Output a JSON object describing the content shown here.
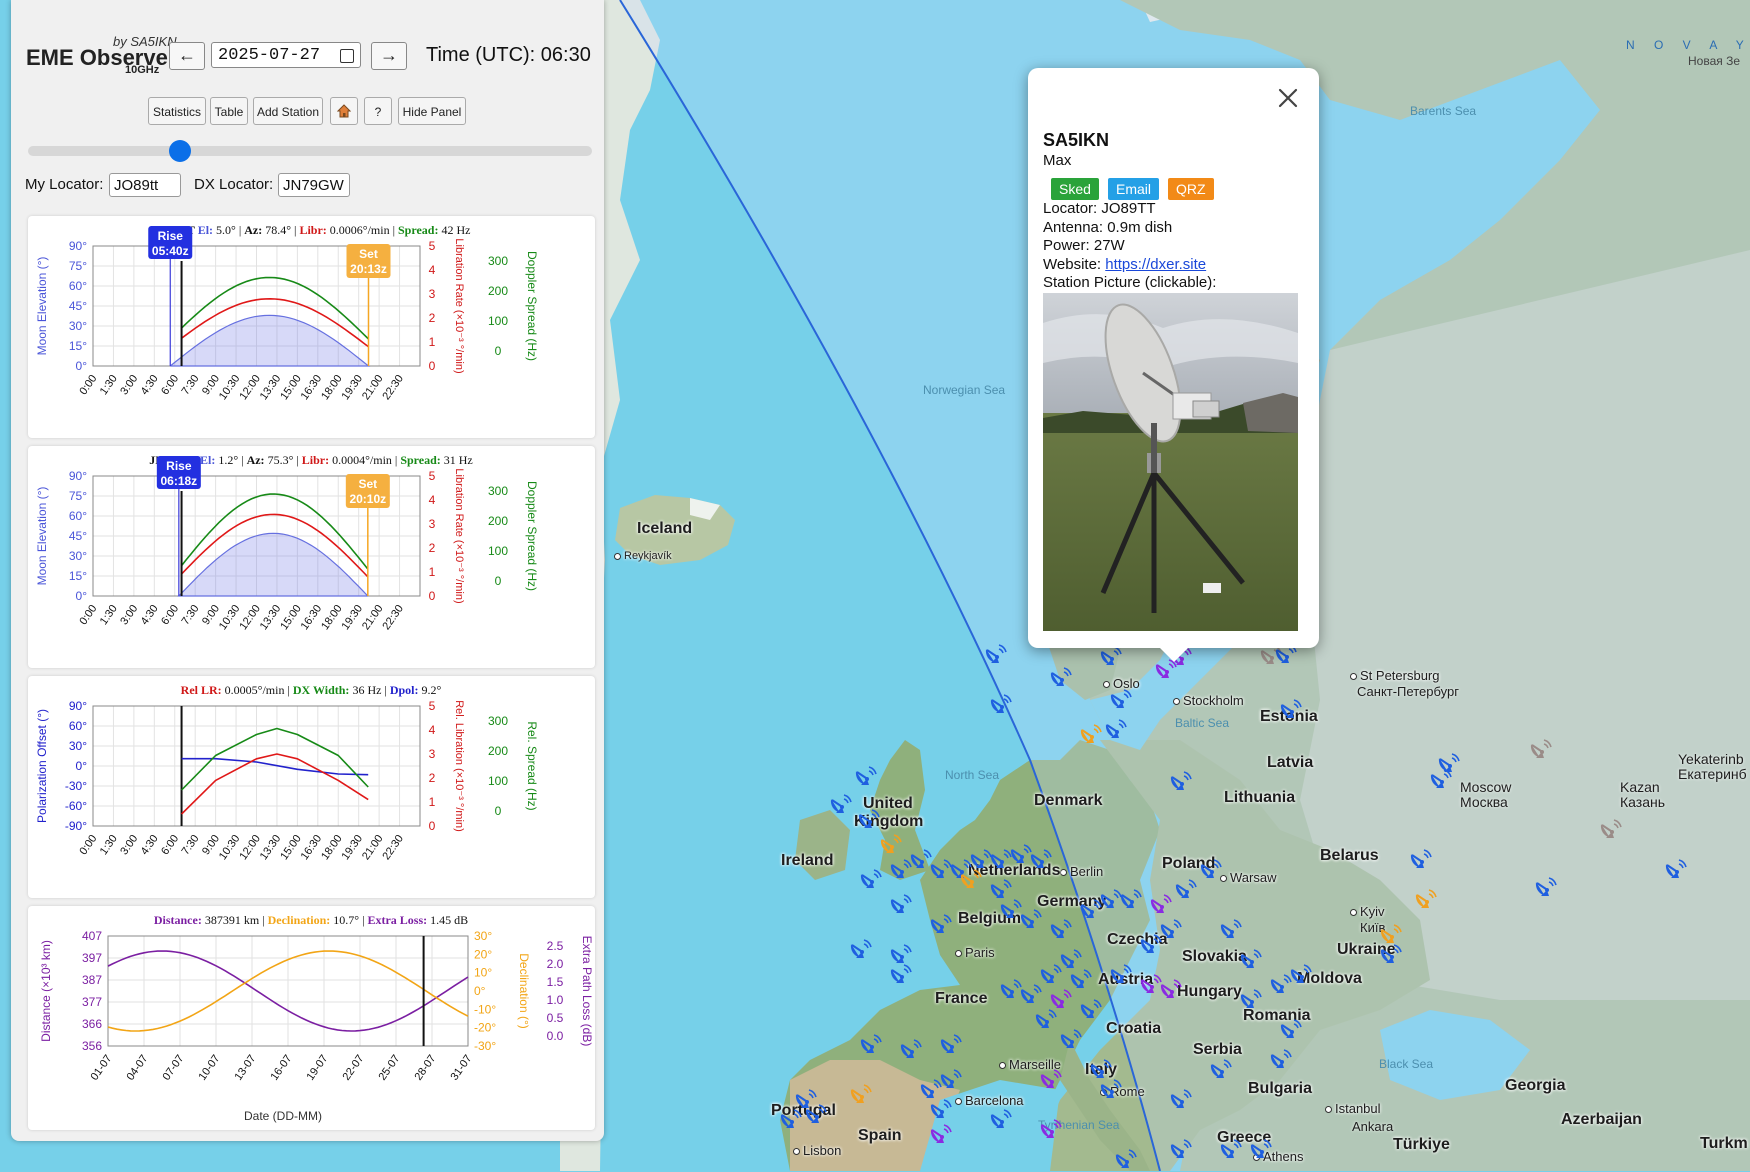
{
  "app": {
    "by_line": "by SA5IKN",
    "title": "EME Observer",
    "band": "10GHz",
    "prev_day_label": "←",
    "next_day_label": "→",
    "date_value": "2025-07-27",
    "time_text": "Time (UTC): 06:30"
  },
  "toolbar": {
    "statistics": "Statistics",
    "table": "Table",
    "add_station": "Add Station",
    "home_icon": "house-icon",
    "help": "?",
    "hide_panel": "Hide Panel"
  },
  "time_slider": {
    "value_fraction": 0.27
  },
  "locators": {
    "my_label": "My Locator:",
    "my_value": "JO89tt",
    "dx_label": "DX Locator:",
    "dx_value": "JN79GW"
  },
  "chart_data": [
    {
      "type": "line",
      "header": {
        "loc": "JO89TT",
        "el": "5.0°",
        "az": "78.4°",
        "libr": "0.0006°/min",
        "spread": "42 Hz"
      },
      "header_labels": {
        "el": "El:",
        "az": "Az:",
        "libr": "Libr:",
        "spread": "Spread:"
      },
      "ylabel_left": "Moon Elevation (°)",
      "ylabel_mid": "Libration Rate (×10⁻³ °/min)",
      "ylabel_right": "Doppler Spread (Hz)",
      "y_left_ticks": [
        "90°",
        "75°",
        "60°",
        "45°",
        "30°",
        "15°",
        "0°"
      ],
      "y_mid_ticks": [
        "5",
        "4",
        "3",
        "2",
        "1",
        "0"
      ],
      "y_right_ticks": [
        "300",
        "200",
        "100",
        "0"
      ],
      "x_ticks": [
        "0:00",
        "1:30",
        "3:00",
        "4:30",
        "6:00",
        "7:30",
        "9:00",
        "10:30",
        "12:00",
        "13:30",
        "15:00",
        "16:30",
        "18:00",
        "19:30",
        "21:00",
        "22:30"
      ],
      "xlim": [
        0,
        24
      ],
      "rise": {
        "label": "Rise",
        "time": "05:40z",
        "hour": 5.67
      },
      "set": {
        "label": "Set",
        "time": "20:13z",
        "hour": 20.22
      },
      "current_hour": 6.5,
      "elevation_peak_deg": 38,
      "libration_peak": 2.8,
      "spread_peak_hz": 245,
      "series_colors": {
        "elevation": "#6670e0",
        "libration": "#e01818",
        "spread": "#178a17"
      }
    },
    {
      "type": "line",
      "header": {
        "loc": "JN79GW",
        "el": "1.2°",
        "az": "75.3°",
        "libr": "0.0004°/min",
        "spread": "31 Hz"
      },
      "header_labels": {
        "el": "El:",
        "az": "Az:",
        "libr": "Libr:",
        "spread": "Spread:"
      },
      "ylabel_left": "Moon Elevation (°)",
      "ylabel_mid": "Libration Rate (×10⁻³ °/min)",
      "ylabel_right": "Doppler Spread (Hz)",
      "y_left_ticks": [
        "90°",
        "75°",
        "60°",
        "45°",
        "30°",
        "15°",
        "0°"
      ],
      "y_mid_ticks": [
        "5",
        "4",
        "3",
        "2",
        "1",
        "0"
      ],
      "y_right_ticks": [
        "300",
        "200",
        "100",
        "0"
      ],
      "x_ticks": [
        "0:00",
        "1:30",
        "3:00",
        "4:30",
        "6:00",
        "7:30",
        "9:00",
        "10:30",
        "12:00",
        "13:30",
        "15:00",
        "16:30",
        "18:00",
        "19:30",
        "21:00",
        "22:30"
      ],
      "xlim": [
        0,
        24
      ],
      "rise": {
        "label": "Rise",
        "time": "06:18z",
        "hour": 6.3
      },
      "set": {
        "label": "Set",
        "time": "20:10z",
        "hour": 20.17
      },
      "current_hour": 6.5,
      "elevation_peak_deg": 47,
      "libration_peak": 3.4,
      "spread_peak_hz": 290,
      "series_colors": {
        "elevation": "#6670e0",
        "libration": "#e01818",
        "spread": "#178a17"
      }
    },
    {
      "type": "line",
      "header": {
        "rel_lr": "0.0005°/min",
        "dx_width": "36 Hz",
        "dpol": "9.2°"
      },
      "header_labels": {
        "rel_lr": "Rel LR:",
        "dx_width": "DX Width:",
        "dpol": "Dpol:"
      },
      "ylabel_left": "Polarization Offset (°)",
      "ylabel_mid": "Rel. Libration (×10⁻³ °/min)",
      "ylabel_right": "Rel. Spread (Hz)",
      "y_left_ticks": [
        "90°",
        "60°",
        "30°",
        "0°",
        "-30°",
        "-60°",
        "-90°"
      ],
      "y_mid_ticks": [
        "5",
        "4",
        "3",
        "2",
        "1",
        "0"
      ],
      "y_right_ticks": [
        "300",
        "200",
        "100",
        "0"
      ],
      "x_ticks": [
        "0:00",
        "1:30",
        "3:00",
        "4:30",
        "6:00",
        "7:30",
        "9:00",
        "10:30",
        "12:00",
        "13:30",
        "15:00",
        "16:30",
        "18:00",
        "19:30",
        "21:00",
        "22:30"
      ],
      "xlim": [
        0,
        24
      ],
      "current_hour": 6.5,
      "series": [
        {
          "name": "Polarization Offset",
          "color": "#2222cc",
          "x": [
            6.5,
            9,
            12,
            15,
            18,
            20.2
          ],
          "y": [
            11,
            11,
            6,
            -5,
            -12,
            -13
          ]
        },
        {
          "name": "Rel. Libration",
          "color": "#e01818",
          "x": [
            6.5,
            9,
            12,
            13.5,
            15,
            18,
            20.2
          ],
          "y": [
            0.5,
            1.9,
            2.8,
            3.0,
            2.8,
            1.9,
            1.1
          ]
        },
        {
          "name": "Rel. Spread",
          "color": "#178a17",
          "x": [
            6.5,
            9,
            12,
            13.5,
            15,
            18,
            20.2
          ],
          "y": [
            70,
            185,
            255,
            275,
            255,
            185,
            80
          ]
        }
      ]
    },
    {
      "type": "line",
      "header": {
        "distance": "387391 km",
        "declination": "10.7°",
        "extra_loss": "1.45 dB"
      },
      "header_labels": {
        "distance": "Distance:",
        "declination": "Declination:",
        "extra_loss": "Extra Loss:"
      },
      "xlabel": "Date (DD-MM)",
      "ylabel_left": "Distance (×10³ km)",
      "ylabel_mid": "Declination (°)",
      "ylabel_right": "Extra Path Loss (dB)",
      "y_left_ticks": [
        "407",
        "397",
        "387",
        "377",
        "366",
        "356"
      ],
      "y_mid_ticks": [
        "30°",
        "20°",
        "10°",
        "0°",
        "-10°",
        "-20°",
        "-30°"
      ],
      "y_right_ticks": [
        "2.5",
        "2.0",
        "1.5",
        "1.0",
        "0.5",
        "0.0"
      ],
      "x_ticks": [
        "01-07",
        "04-07",
        "07-07",
        "10-07",
        "13-07",
        "16-07",
        "19-07",
        "22-07",
        "25-07",
        "28-07",
        "31-07"
      ],
      "current_day": 27.3,
      "series": [
        {
          "name": "Distance",
          "color": "#7b1fa2"
        },
        {
          "name": "Declination",
          "color": "#f2a516"
        }
      ]
    }
  ],
  "popup": {
    "close_icon": "close-icon",
    "callsign": "SA5IKN",
    "name": "Max",
    "sked": "Sked",
    "email": "Email",
    "qrz": "QRZ",
    "locator": "Locator: JO89TT",
    "antenna": "Antenna: 0.9m dish",
    "power": "Power: 27W",
    "website_label": "Website: ",
    "website_link": "https://dxer.site",
    "picture_label": "Station Picture (clickable):",
    "picture_icon": "station-dish-photo",
    "colors": {
      "sked": "#2aa33a",
      "email": "#24a0e6",
      "qrz": "#f28a17"
    }
  },
  "map": {
    "countries": [
      "Iceland",
      "United Kingdom",
      "Ireland",
      "France",
      "Spain",
      "Portugal",
      "Italy",
      "Germany",
      "Belgium",
      "Netherlands",
      "Denmark",
      "Poland",
      "Czechia",
      "Austria",
      "Slovakia",
      "Hungary",
      "Croatia",
      "Serbia",
      "Romania",
      "Bulgaria",
      "Greece",
      "Türkiye",
      "Moldova",
      "Ukraine",
      "Belarus",
      "Lithuania",
      "Latvia",
      "Estonia",
      "Georgia",
      "Azerbaijan",
      "Turkmenistan"
    ],
    "labels": {
      "iceland": "Iceland",
      "reykjavik": "Reykjavík",
      "norwegian_sea": "Norwegian Sea",
      "barents_sea": "Barents Sea",
      "novaya": "N O V A Y A   Z",
      "novaya_ru": "Новая Зе",
      "st_petersburg": "St Petersburg",
      "st_petersburg_ru": "Санкт-Петербург",
      "oslo": "Oslo",
      "stockholm": "Stockholm",
      "baltic_sea": "Baltic Sea",
      "estonia": "Estonia",
      "latvia": "Latvia",
      "lithuania": "Lithuania",
      "moscow": "Moscow",
      "moscow_ru": "Москва",
      "kazan": "Kazan",
      "kazan_ru": "Казань",
      "yekaterinburg": "Yekaterinb",
      "yekaterinburg_ru": "Екатеринб",
      "north_sea": "North Sea",
      "united": "United",
      "kingdom": "Kingdom",
      "ireland": "Ireland",
      "denmark": "Denmark",
      "poland": "Poland",
      "warsaw": "Warsaw",
      "belarus": "Belarus",
      "berlin": "Berlin",
      "netherlands": "Netherlands",
      "germany": "Germany",
      "belgium": "Belgium",
      "paris": "Paris",
      "czechia": "Czechia",
      "slovakia": "Slovakia",
      "kyiv": "Kyiv",
      "kyiv_ru": "Київ",
      "ukraine": "Ukraine",
      "austria": "Austria",
      "hungary": "Hungary",
      "moldova": "Moldova",
      "france": "France",
      "croatia": "Croatia",
      "romania": "Romania",
      "serbia": "Serbia",
      "black_sea": "Black Sea",
      "marseille": "Marseille",
      "italy": "Italy",
      "rome": "Rome",
      "bulgaria": "Bulgaria",
      "georgia": "Georgia",
      "istanbul": "Istanbul",
      "portugal": "Portugal",
      "barcelona": "Barcelona",
      "ankara": "Ankara",
      "azerbaijan": "Azerbaijan",
      "spain": "Spain",
      "tyrrhenian_sea": "Tyrrhenian Sea",
      "greece": "Greece",
      "turkiye": "Türkiye",
      "lisbon": "Lisbon",
      "athens": "Athens",
      "turkm": "Turkm"
    },
    "marker_colors": {
      "station": "#1f5fe0",
      "active": "#f0a020",
      "sked": "#8a2be2",
      "inactive": "#9a8c88"
    }
  }
}
